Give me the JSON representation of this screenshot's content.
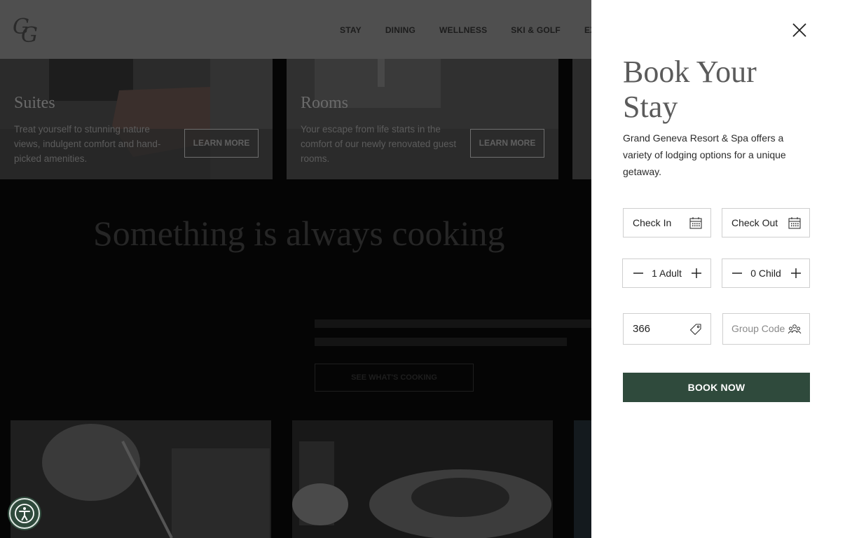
{
  "header": {
    "logo_text": "GG",
    "nav": [
      "STAY",
      "DINING",
      "WELLNESS",
      "SKI & GOLF",
      "EXP"
    ]
  },
  "cards": [
    {
      "title": "Suites",
      "description": "Treat yourself to stunning nature views, indulgent comfort and hand-picked amenities.",
      "button": "LEARN MORE"
    },
    {
      "title": "Rooms",
      "description": "Your escape from life starts in the comfort of our newly renovated guest rooms.",
      "button": "LEARN MORE"
    }
  ],
  "cooking": {
    "heading": "Something is always cooking",
    "button": "SEE WHAT'S COOKING"
  },
  "booking": {
    "title": "Book Your Stay",
    "description": "Grand Geneva Resort & Spa offers a variety of lodging options for a unique getaway.",
    "check_in": "Check In",
    "check_out": "Check Out",
    "adults": "1 Adult",
    "children": "0 Child",
    "promo_code": "366",
    "group_code_placeholder": "Group Code",
    "book_button": "BOOK NOW"
  },
  "icons": {
    "close": "close-icon",
    "calendar": "calendar-icon",
    "tag": "tag-icon",
    "group": "group-icon",
    "accessibility": "accessibility-icon"
  },
  "colors": {
    "brand_green": "#2f4a3c",
    "panel_bg": "#ffffff",
    "title_gray": "#5b5b5b"
  }
}
